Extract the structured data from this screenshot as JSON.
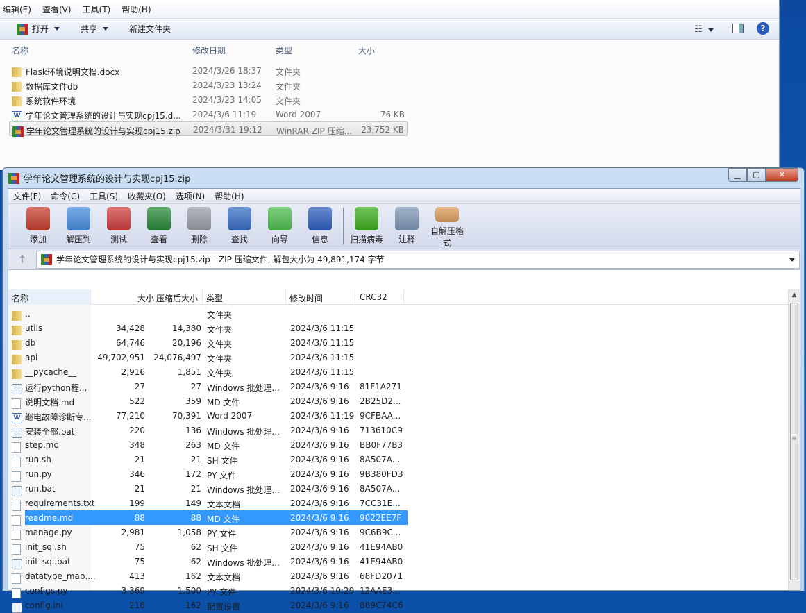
{
  "explorer": {
    "menu": [
      "编辑(E)",
      "查看(V)",
      "工具(T)",
      "帮助(H)"
    ],
    "toolbar": {
      "open": "打开",
      "share": "共享",
      "new_folder": "新建文件夹"
    },
    "columns": [
      "名称",
      "修改日期",
      "类型",
      "大小"
    ],
    "files": [
      {
        "name": "Flask环境说明文档.docx",
        "date": "2024/3/26 18:37",
        "type": "文件夹",
        "size": "",
        "icon": "folder"
      },
      {
        "name": "数据库文件db",
        "date": "2024/3/23 13:24",
        "type": "文件夹",
        "size": "",
        "icon": "folder"
      },
      {
        "name": "系统软件环境",
        "date": "2024/3/23 14:05",
        "type": "文件夹",
        "size": "",
        "icon": "folder"
      },
      {
        "name": "学年论文管理系统的设计与实现cpj15.d...",
        "date": "2024/3/6 11:19",
        "type": "Word 2007",
        "size": "76 KB",
        "icon": "word"
      },
      {
        "name": "学年论文管理系统的设计与实现cpj15.zip",
        "date": "2024/3/31 19:12",
        "type": "WinRAR ZIP 压缩...",
        "size": "23,752 KB",
        "icon": "rar",
        "selected": true
      }
    ]
  },
  "winrar": {
    "title": "学年论文管理系统的设计与实现cpj15.zip",
    "menu": [
      "文件(F)",
      "命令(C)",
      "工具(S)",
      "收藏夹(O)",
      "选项(N)",
      "帮助(H)"
    ],
    "toolbar": [
      {
        "label": "添加",
        "color": "#c84030"
      },
      {
        "label": "解压到",
        "color": "#4a90e0"
      },
      {
        "label": "测试",
        "color": "#d04040"
      },
      {
        "label": "查看",
        "color": "#2a8a3a"
      },
      {
        "label": "删除",
        "color": "#9aa0a8"
      },
      {
        "label": "查找",
        "color": "#3a70c8"
      },
      {
        "label": "向导",
        "color": "#50c050"
      },
      {
        "label": "信息",
        "color": "#3060c0"
      },
      {
        "label": "扫描病毒",
        "color": "#40b020"
      },
      {
        "label": "注释",
        "color": "#8098b8"
      },
      {
        "label": "自解压格式",
        "color": "#e0a060"
      }
    ],
    "address": "学年论文管理系统的设计与实现cpj15.zip - ZIP 压缩文件, 解包大小为 49,891,174 字节",
    "columns": [
      "名称",
      "大小",
      "压缩后大小",
      "类型",
      "修改时间",
      "CRC32"
    ],
    "files": [
      {
        "name": "..",
        "size": "",
        "packed": "",
        "type": "文件夹",
        "modified": "",
        "crc": "",
        "icon": "folder"
      },
      {
        "name": "utils",
        "size": "34,428",
        "packed": "14,380",
        "type": "文件夹",
        "modified": "2024/3/6 11:15",
        "crc": "",
        "icon": "folder"
      },
      {
        "name": "db",
        "size": "64,746",
        "packed": "20,196",
        "type": "文件夹",
        "modified": "2024/3/6 11:15",
        "crc": "",
        "icon": "folder"
      },
      {
        "name": "api",
        "size": "49,702,951",
        "packed": "24,076,497",
        "type": "文件夹",
        "modified": "2024/3/6 11:15",
        "crc": "",
        "icon": "folder"
      },
      {
        "name": "__pycache__",
        "size": "2,916",
        "packed": "1,851",
        "type": "文件夹",
        "modified": "2024/3/6 11:15",
        "crc": "",
        "icon": "folder"
      },
      {
        "name": "运行python程...",
        "size": "27",
        "packed": "27",
        "type": "Windows 批处理...",
        "modified": "2024/3/6 9:16",
        "crc": "81F1A271",
        "icon": "bat"
      },
      {
        "name": "说明文档.md",
        "size": "522",
        "packed": "359",
        "type": "MD 文件",
        "modified": "2024/3/6 9:16",
        "crc": "2B25D2...",
        "icon": "doc"
      },
      {
        "name": "继电故障诊断专...",
        "size": "77,210",
        "packed": "70,391",
        "type": "Word 2007",
        "modified": "2024/3/6 11:19",
        "crc": "9CFBAA...",
        "icon": "word"
      },
      {
        "name": "安装全部.bat",
        "size": "220",
        "packed": "136",
        "type": "Windows 批处理...",
        "modified": "2024/3/6 9:16",
        "crc": "713610C9",
        "icon": "bat"
      },
      {
        "name": "step.md",
        "size": "348",
        "packed": "263",
        "type": "MD 文件",
        "modified": "2024/3/6 9:16",
        "crc": "BB0F77B3",
        "icon": "doc"
      },
      {
        "name": "run.sh",
        "size": "21",
        "packed": "21",
        "type": "SH 文件",
        "modified": "2024/3/6 9:16",
        "crc": "8A507A...",
        "icon": "doc"
      },
      {
        "name": "run.py",
        "size": "346",
        "packed": "172",
        "type": "PY 文件",
        "modified": "2024/3/6 9:16",
        "crc": "9B380FD3",
        "icon": "doc"
      },
      {
        "name": "run.bat",
        "size": "21",
        "packed": "21",
        "type": "Windows 批处理...",
        "modified": "2024/3/6 9:16",
        "crc": "8A507A...",
        "icon": "bat"
      },
      {
        "name": "requirements.txt",
        "size": "199",
        "packed": "149",
        "type": "文本文档",
        "modified": "2024/3/6 9:16",
        "crc": "7CC31E...",
        "icon": "doc"
      },
      {
        "name": "readme.md",
        "size": "88",
        "packed": "88",
        "type": "MD 文件",
        "modified": "2024/3/6 9:16",
        "crc": "9022EE7F",
        "icon": "doc",
        "selected": true
      },
      {
        "name": "manage.py",
        "size": "2,981",
        "packed": "1,058",
        "type": "PY 文件",
        "modified": "2024/3/6 9:16",
        "crc": "9C6B9C...",
        "icon": "doc"
      },
      {
        "name": "init_sql.sh",
        "size": "75",
        "packed": "62",
        "type": "SH 文件",
        "modified": "2024/3/6 9:16",
        "crc": "41E94AB0",
        "icon": "doc"
      },
      {
        "name": "init_sql.bat",
        "size": "75",
        "packed": "62",
        "type": "Windows 批处理...",
        "modified": "2024/3/6 9:16",
        "crc": "41E94AB0",
        "icon": "bat"
      },
      {
        "name": "datatype_map....",
        "size": "413",
        "packed": "162",
        "type": "文本文档",
        "modified": "2024/3/6 9:16",
        "crc": "68FD2071",
        "icon": "doc"
      },
      {
        "name": "configs.py",
        "size": "3,369",
        "packed": "1,500",
        "type": "PY 文件",
        "modified": "2024/3/6 10:29",
        "crc": "12AAE3...",
        "icon": "doc"
      },
      {
        "name": "config.ini",
        "size": "218",
        "packed": "162",
        "type": "配置设置",
        "modified": "2024/3/6 9:16",
        "crc": "889C74C6",
        "icon": "bat"
      }
    ]
  }
}
